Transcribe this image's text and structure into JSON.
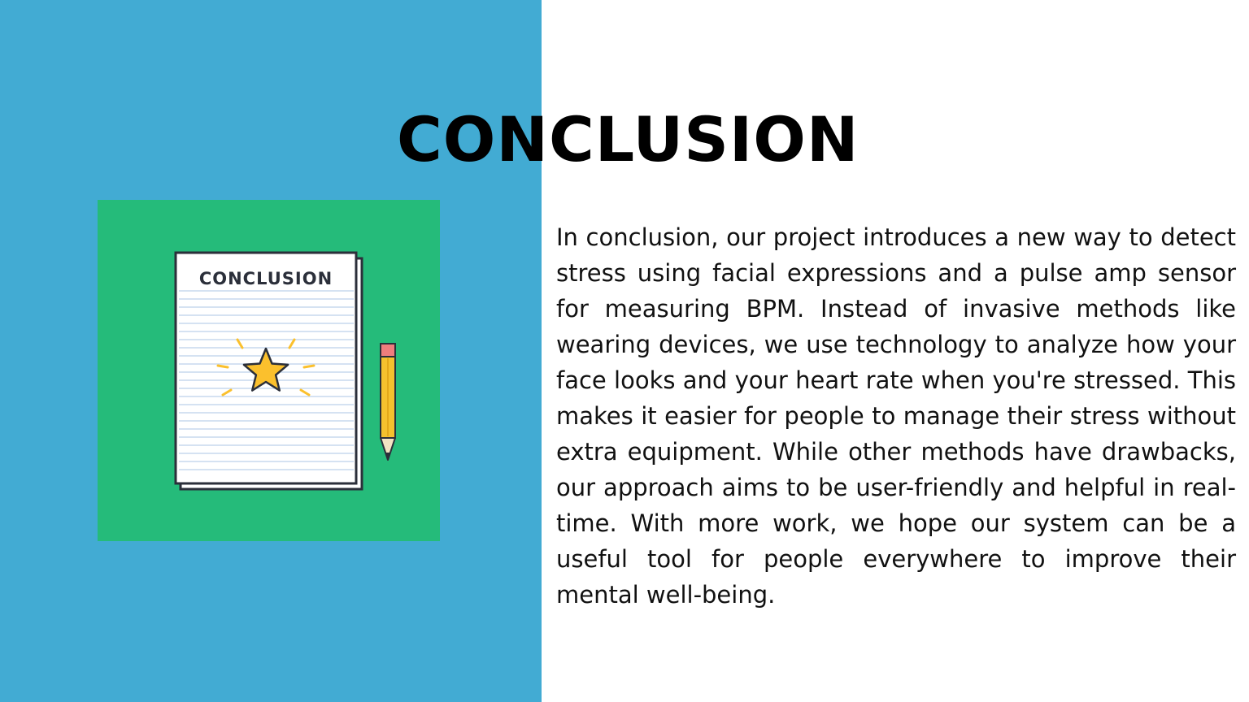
{
  "slide": {
    "title": "CONCLUSION",
    "illustration": {
      "paper_heading": "CONCLUSION",
      "icons": [
        "document-icon",
        "star-icon",
        "pencil-icon"
      ]
    },
    "body": "In conclusion, our project introduces a new way to detect stress using facial expressions and a pulse amp sensor for measuring BPM. Instead of invasive methods like wearing devices, we use technology to analyze how your face looks and your heart rate when you're stressed. This makes it easier for people to manage their stress without extra equipment. While other methods have drawbacks, our approach aims to be user-friendly and helpful in real-time. With more work, we hope our system can be a useful tool for people everywhere to improve their mental well-being."
  },
  "colors": {
    "left_panel": "#42abd3",
    "illustration_bg": "#25bb7a",
    "star": "#fbc02d",
    "pencil": "#f5c12e"
  }
}
